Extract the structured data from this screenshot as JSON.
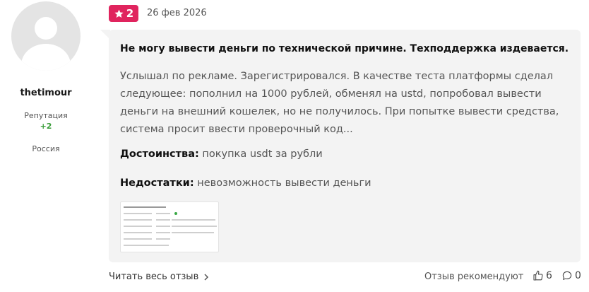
{
  "user": {
    "name": "thetimour",
    "reputation_label": "Репутация",
    "reputation_value": "+2",
    "country": "Россия"
  },
  "review": {
    "rating": "2",
    "date": "26 фев 2026",
    "title": "Не могу вывести деньги по технической причине. Техподдержка издевается.",
    "text": "Услышал по рекламе. Зарегистрировался. В качестве теста платформы сделал следующее: пополнил на 1000 рублей, обменял на ustd, попробовал вывести деньги на внешний кошелек, но не получилось. При попытке вывести средства, система просит ввести проверочный код...",
    "pros_label": "Достоинства:",
    "pros": "покупка usdt за рубли",
    "cons_label": "Недостатки:",
    "cons": "невозможность вывести деньги"
  },
  "footer": {
    "read_more": "Читать весь отзыв",
    "recommended": "Отзыв рекомендуют",
    "likes": "6",
    "comments": "0"
  },
  "colors": {
    "rating_badge": "#e0245e",
    "reputation_positive": "#3a9e3a",
    "bubble_bg": "#f3f3f3"
  },
  "icons": {
    "rating": "star-icon",
    "read_more": "chevron-right-icon",
    "likes": "thumbs-up-icon",
    "comments": "comment-icon"
  }
}
